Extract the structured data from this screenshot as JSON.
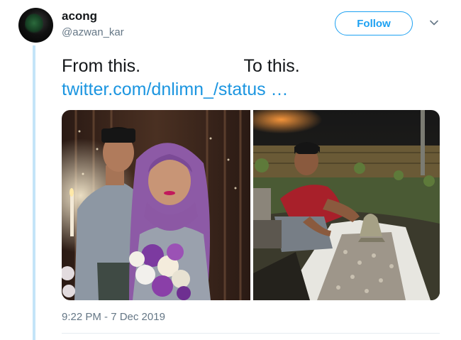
{
  "user": {
    "display_name": "acong",
    "handle": "@azwan_kar"
  },
  "follow_label": "Follow",
  "tweet": {
    "line1": "From this.                     To this.",
    "link_text": "twitter.com/dnlimn_/status …"
  },
  "timestamp": "9:22 PM - 7 Dec 2019",
  "colors": {
    "accent": "#1da1f2",
    "link": "#1b95e0",
    "muted": "#657786",
    "thread_line": "#c4e4f8"
  }
}
